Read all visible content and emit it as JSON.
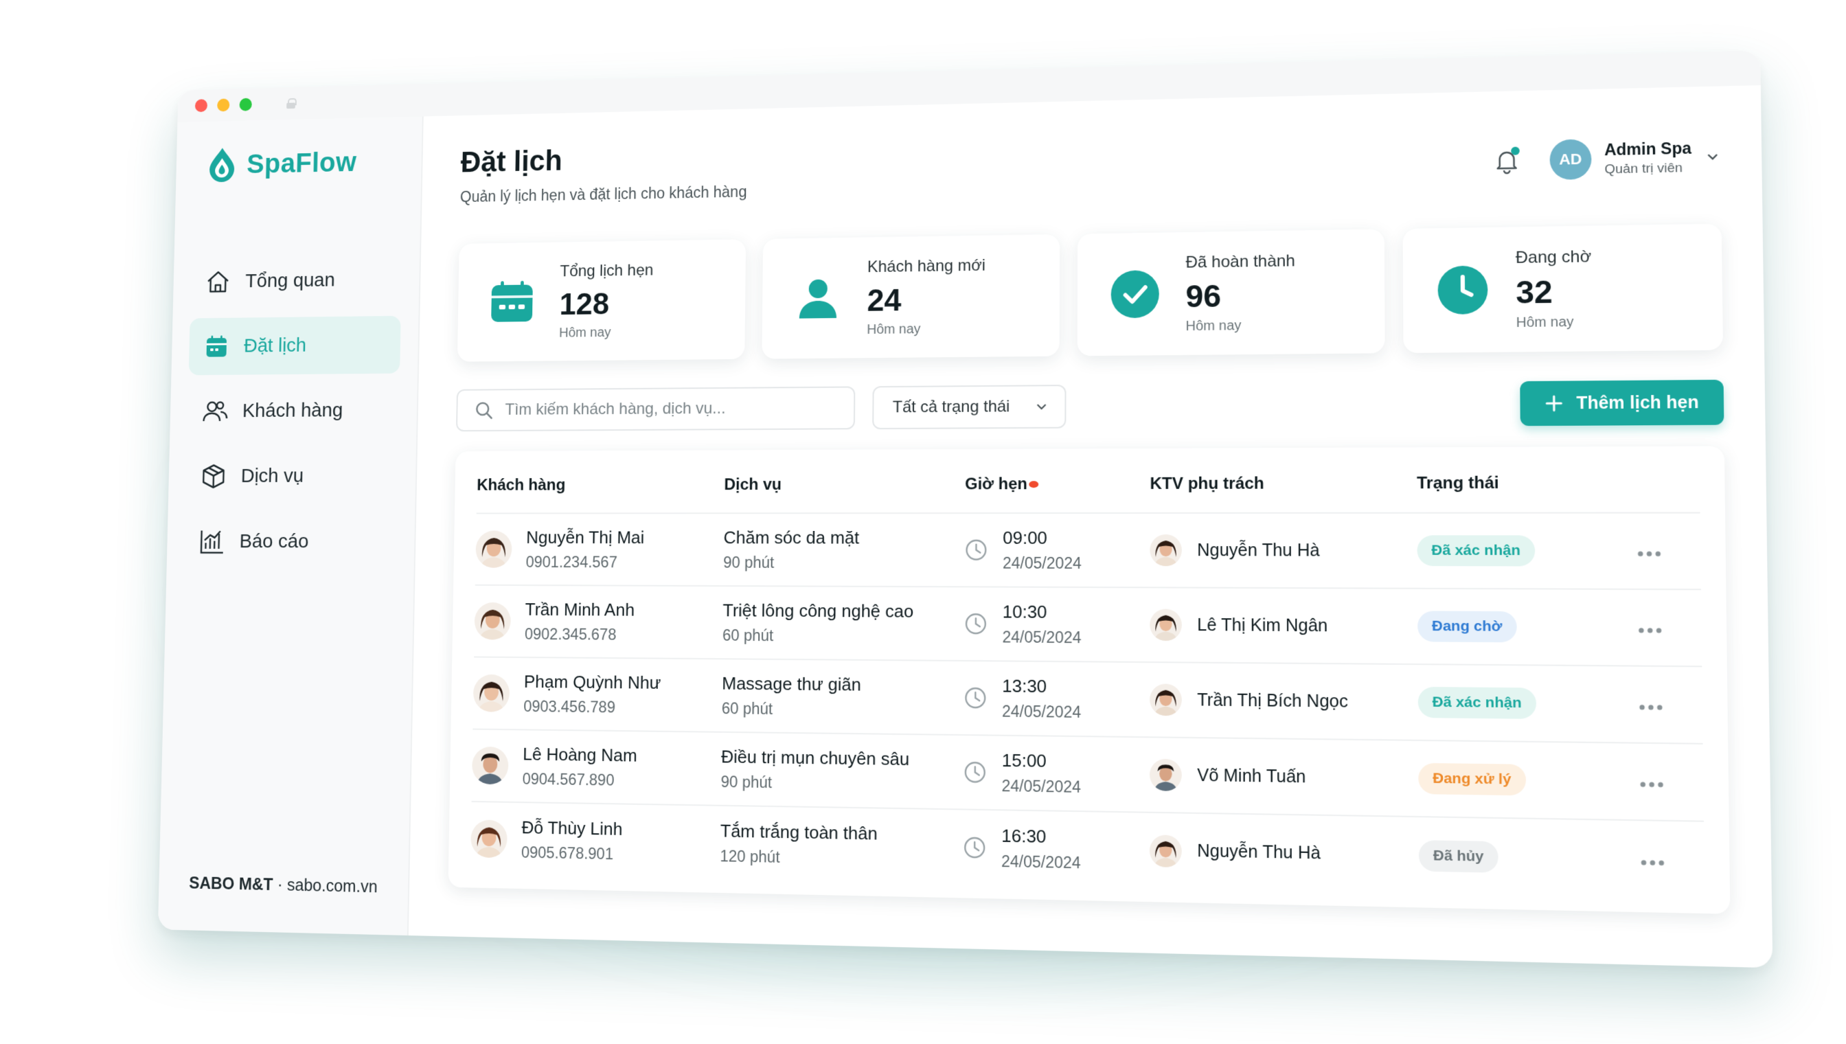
{
  "app": {
    "name": "SpaFlow",
    "footer_brand": "SABO M&T",
    "footer_sep": " · ",
    "footer_site": "sabo.com.vn"
  },
  "sidebar": {
    "items": [
      {
        "label": "Tổng quan",
        "icon": "home-icon",
        "active": false
      },
      {
        "label": "Đặt lịch",
        "icon": "calendar-icon",
        "active": true
      },
      {
        "label": "Khách hàng",
        "icon": "users-icon",
        "active": false
      },
      {
        "label": "Dịch vụ",
        "icon": "box-icon",
        "active": false
      },
      {
        "label": "Báo cáo",
        "icon": "chart-icon",
        "active": false
      }
    ]
  },
  "header": {
    "title": "Đặt lịch",
    "subtitle": "Quản lý lịch hẹn và đặt lịch cho khách hàng",
    "user_initials": "AD",
    "user_name": "Admin Spa",
    "user_role": "Quản trị viên"
  },
  "stats": [
    {
      "label": "Tổng lịch hẹn",
      "value": "128",
      "sub": "Hôm nay",
      "icon": "calendar-icon"
    },
    {
      "label": "Khách hàng mới",
      "value": "24",
      "sub": "Hôm nay",
      "icon": "user-icon"
    },
    {
      "label": "Đã hoàn thành",
      "value": "96",
      "sub": "Hôm nay",
      "icon": "check-circle-icon"
    },
    {
      "label": "Đang chờ",
      "value": "32",
      "sub": "Hôm nay",
      "icon": "clock-icon"
    }
  ],
  "toolbar": {
    "search_placeholder": "Tìm kiếm khách hàng, dịch vụ...",
    "filter_value": "Tất cả trạng thái",
    "add_label": "Thêm lịch hẹn"
  },
  "table": {
    "headers": [
      "Khách hàng",
      "Dịch vụ",
      "Giờ hẹn",
      "KTV phụ trách",
      "Trạng thái"
    ],
    "rows": [
      {
        "name": "Nguyễn Thị Mai",
        "phone": "0901.234.567",
        "service": "Chăm sóc da mặt",
        "duration": "90 phút",
        "time": "09:00",
        "date": "24/05/2024",
        "ktv": "Nguyễn Thu Hà",
        "status": "Đã xác nhận",
        "status_type": "confirmed"
      },
      {
        "name": "Trần Minh Anh",
        "phone": "0902.345.678",
        "service": "Triệt lông công nghệ cao",
        "duration": "60 phút",
        "time": "10:30",
        "date": "24/05/2024",
        "ktv": "Lê Thị Kim Ngân",
        "status": "Đang chờ",
        "status_type": "waiting"
      },
      {
        "name": "Phạm Quỳnh Như",
        "phone": "0903.456.789",
        "service": "Massage thư giãn",
        "duration": "60 phút",
        "time": "13:30",
        "date": "24/05/2024",
        "ktv": "Trần Thị Bích Ngọc",
        "status": "Đã xác nhận",
        "status_type": "confirmed"
      },
      {
        "name": "Lê Hoàng Nam",
        "phone": "0904.567.890",
        "service": "Điều trị mụn chuyên sâu",
        "duration": "90 phút",
        "time": "15:00",
        "date": "24/05/2024",
        "ktv": "Võ Minh Tuấn",
        "status": "Đang xử lý",
        "status_type": "processing"
      },
      {
        "name": "Đỗ Thùy Linh",
        "phone": "0905.678.901",
        "service": "Tắm trắng toàn thân",
        "duration": "120 phút",
        "time": "16:30",
        "date": "24/05/2024",
        "ktv": "Nguyễn Thu Hà",
        "status": "Đã hủy",
        "status_type": "cancelled"
      }
    ]
  },
  "colors": {
    "brand": "#1aa89e",
    "confirmed": "#1aa89e",
    "waiting": "#2f7bd3",
    "processing": "#ee8a2a",
    "cancelled": "#6b7579"
  }
}
